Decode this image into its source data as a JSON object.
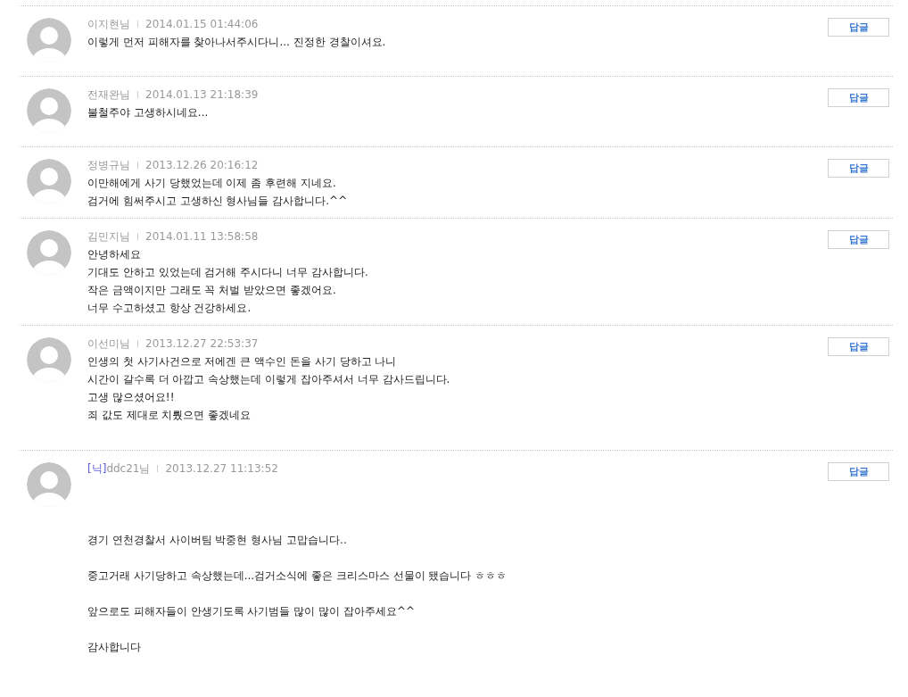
{
  "comments": [
    {
      "author": "이지현님",
      "date": "2014.01.15 01:44:06",
      "reply": "답글",
      "spaced": false,
      "lines": [
        "이렇게 먼저 피해자를 찾아나서주시다니... 진정한 경찰이셔요."
      ]
    },
    {
      "author": "전재완님",
      "date": "2014.01.13 21:18:39",
      "reply": "답글",
      "spaced": false,
      "lines": [
        "불철주야 고생하시네요..."
      ]
    },
    {
      "author": "정병규님",
      "date": "2013.12.26 20:16:12",
      "reply": "답글",
      "spaced": false,
      "lines": [
        "이만해에게 사기 당했었는데 이제 좀 후련해 지네요.",
        "검거에 힘써주시고 고생하신 형사님들 감사합니다.^^"
      ]
    },
    {
      "author": "김민지님",
      "date": "2014.01.11 13:58:58",
      "reply": "답글",
      "spaced": false,
      "lines": [
        "안녕하세요",
        "기대도 안하고 있었는데 검거해 주시다니 너무 감사합니다.",
        "작은 금액이지만 그래도 꼭 처벌 받았으면 좋겠어요.",
        "너무 수고하셨고 항상 건강하세요."
      ]
    },
    {
      "author": "이선미님",
      "date": "2013.12.27 22:53:37",
      "reply": "답글",
      "spaced": false,
      "lines": [
        "인생의 첫 사기사건으로 저에겐 큰 액수인 돈을 사기 당하고 나니",
        "시간이 갈수록 더 아깝고 속상했는데 이렇게 잡아주셔서 너무 감사드립니다.",
        "고생 많으셨어요!!",
        "죄 값도 제대로 치뤘으면 좋겠네요"
      ]
    },
    {
      "tag": "[닉]",
      "author": "ddc21님",
      "date": "2013.12.27 11:13:52",
      "reply": "답글",
      "spaced": true,
      "lines": [
        "경기 연천경찰서 사이버팀 박중현 형사님 고맙습니다..",
        "중고거래 사기당하고 속상했는데...검거소식에 좋은 크리스마스 선물이 됐습니다 ㅎㅎㅎ",
        "앞으로도 피해자들이 안생기도록 사기범들 많이 많이 잡아주세요^^",
        "감사합니다"
      ]
    }
  ]
}
